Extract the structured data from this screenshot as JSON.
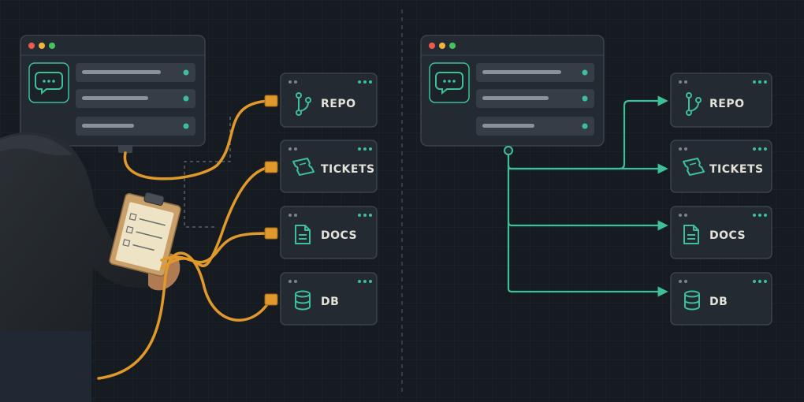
{
  "left_panel": {
    "services": [
      {
        "key": "repo",
        "label": "REPO"
      },
      {
        "key": "tickets",
        "label": "TICKETS"
      },
      {
        "key": "docs",
        "label": "DOCS"
      },
      {
        "key": "db",
        "label": "DB"
      }
    ]
  },
  "right_panel": {
    "services": [
      {
        "key": "repo",
        "label": "REPO"
      },
      {
        "key": "tickets",
        "label": "TICKETS"
      },
      {
        "key": "docs",
        "label": "DOCS"
      },
      {
        "key": "db",
        "label": "DB"
      }
    ]
  },
  "colors": {
    "background": "#151b21",
    "window": "#232a32",
    "accent_teal": "#3dbf9a",
    "cable_orange": "#e0992a",
    "dot_red": "#ee5a4e",
    "dot_yellow": "#f2b43a",
    "dot_green": "#43c45e"
  },
  "icons": {
    "chat": "chat-bubble-icon",
    "repo": "git-branch-icon",
    "tickets": "ticket-icon",
    "docs": "document-icon",
    "db": "database-icon",
    "clipboard": "clipboard-icon"
  }
}
